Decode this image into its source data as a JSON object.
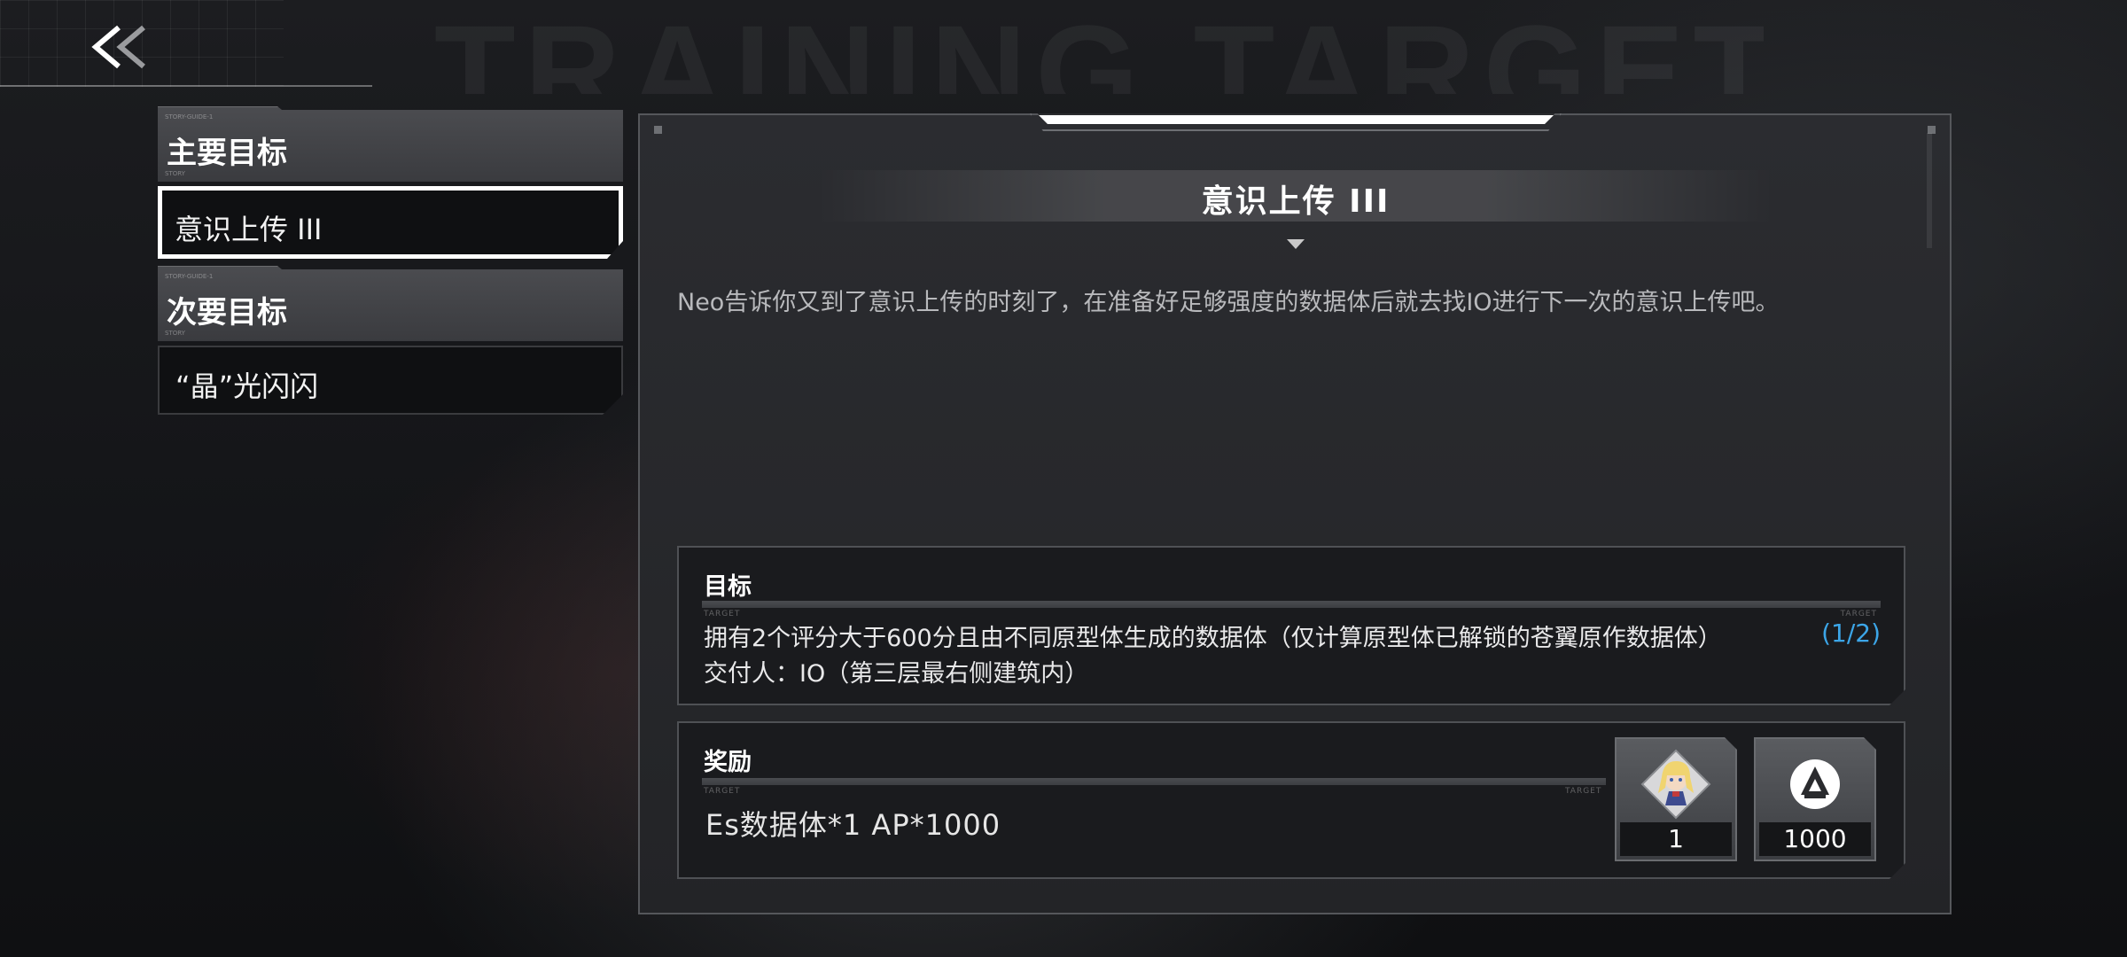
{
  "header": {
    "back_label": "<<",
    "background_title": "TRAINING TARGET"
  },
  "menu": {
    "main_header": "主要目标",
    "main_items": [
      "意识上传 III"
    ],
    "secondary_header": "次要目标",
    "secondary_items": [
      "“晶”光闪闪"
    ],
    "header_tiny_top": "STORY-GUIDE-1",
    "header_tiny_bottom": "STORY"
  },
  "panel": {
    "title": "意识上传 III",
    "description": "Neo告诉你又到了意识上传的时刻了，在准备好足够强度的数据体后就去找IO进行下一次的意识上传吧。",
    "target": {
      "heading": "目标",
      "rule_label": "TARGET",
      "objective": "拥有2个评分大于600分且由不同原型体生成的数据体（仅计算原型体已解锁的苍翼原作数据体）",
      "progress": "(1/2)",
      "deliver_to": "交付人：IO（第三层最右侧建筑内）"
    },
    "reward": {
      "heading": "奖励",
      "rule_label": "TARGET",
      "summary": "Es数据体*1  AP*1000",
      "items": [
        {
          "icon": "character-portrait-icon",
          "count": "1"
        },
        {
          "icon": "ap-logo-icon",
          "count": "1000"
        }
      ]
    }
  },
  "colors": {
    "progress": "#3ca6e8",
    "active_border": "#ffffff"
  }
}
